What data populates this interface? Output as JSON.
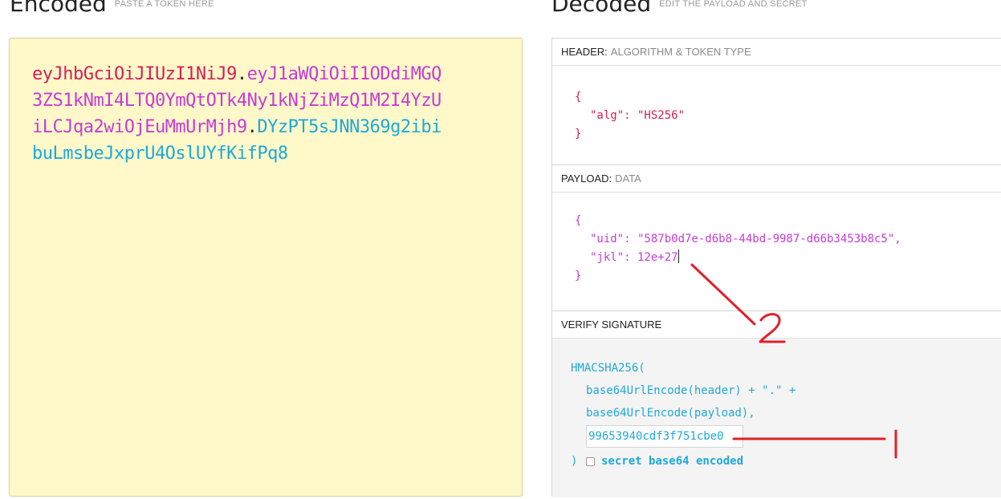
{
  "encoded": {
    "title": "Encoded",
    "subtitle": "PASTE A TOKEN HERE",
    "token": {
      "line1_header": "eyJhbGciOiJIUzI1NiJ9",
      "line1_dot": ".",
      "line1_payload": "eyJ1aWQiOiI1ODdiMGQ",
      "line2_payload": "3ZS1kNmI4LTQ0YmQtOTk4Ny1kNjZiMzQ1M2I4YzU",
      "line3_payload": "iLCJqa2wiOjEuMmUrMjh9",
      "line3_dot": ".",
      "line3_signature": "DYzPT5sJNN369g2ibi",
      "line4_signature": "buLmsbeJxprU4OslUYfKifPq8"
    }
  },
  "decoded": {
    "title": "Decoded",
    "subtitle": "EDIT THE PAYLOAD AND SECRET",
    "header": {
      "label": "HEADER:",
      "sublabel": "ALGORITHM & TOKEN TYPE",
      "open_brace": "{",
      "line_alg": "\"alg\": \"HS256\"",
      "close_brace": "}"
    },
    "payload": {
      "label": "PAYLOAD:",
      "sublabel": "DATA",
      "open_brace": "{",
      "line_uid": "\"uid\": \"587b0d7e-d6b8-44bd-9987-d66b3453b8c5\",",
      "line_jkl": "\"jkl\": 12e+27",
      "close_brace": "}"
    },
    "verify": {
      "label": "VERIFY SIGNATURE",
      "line1": "HMACSHA256(",
      "line2": "base64UrlEncode(header) + \".\" +",
      "line3": "base64UrlEncode(payload),",
      "secret_value": "99653940cdf3f751cbe0",
      "close_paren": ")",
      "secret_label": "secret base64 encoded"
    }
  },
  "annotations": {
    "marker_1": "1",
    "marker_2": "2",
    "color": "#e0202a"
  },
  "colors": {
    "header_red": "#d41f56",
    "payload_purple": "#c63bd6",
    "signature_blue": "#1ea9d9",
    "encoded_bg": "#fff8c9"
  }
}
